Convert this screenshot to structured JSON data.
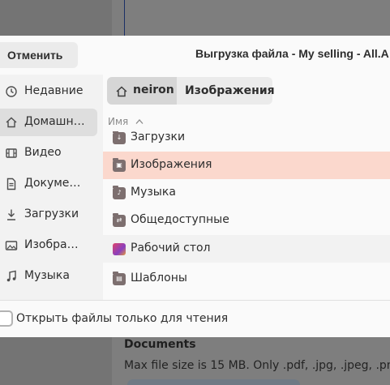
{
  "background": {
    "heading": "Documents",
    "description": "Max file size is 15 MB. Only .pdf, .jpg, .jpeg, .png f"
  },
  "dialog": {
    "cancel_label": "Отменить",
    "title": "Выгрузка файла - My selling - All.A",
    "sidebar": {
      "items": [
        {
          "label": "Недавние",
          "icon": "clock-icon"
        },
        {
          "label": "Домашн…",
          "icon": "home-icon"
        },
        {
          "label": "Видео",
          "icon": "film-icon"
        },
        {
          "label": "Докуме…",
          "icon": "document-icon"
        },
        {
          "label": "Загрузки",
          "icon": "download-icon"
        },
        {
          "label": "Изобра…",
          "icon": "image-icon"
        },
        {
          "label": "Музыка",
          "icon": "music-icon"
        }
      ]
    },
    "pathbar": {
      "home_label": "neiron",
      "current_label": "Изображения"
    },
    "column_header": "Имя",
    "files": [
      {
        "label": "Загрузки",
        "icon": "folder-download-icon"
      },
      {
        "label": "Изображения",
        "icon": "folder-pictures-icon"
      },
      {
        "label": "Музыка",
        "icon": "folder-music-icon"
      },
      {
        "label": "Общедоступные",
        "icon": "folder-public-icon"
      },
      {
        "label": "Рабочий стол",
        "icon": "folder-desktop-icon"
      },
      {
        "label": "Шаблоны",
        "icon": "folder-templates-icon"
      }
    ],
    "readonly_label": "Открыть файлы только для чтения"
  },
  "colors": {
    "selected_row": "#fbd8cd",
    "folder": "#7d6f6f"
  }
}
